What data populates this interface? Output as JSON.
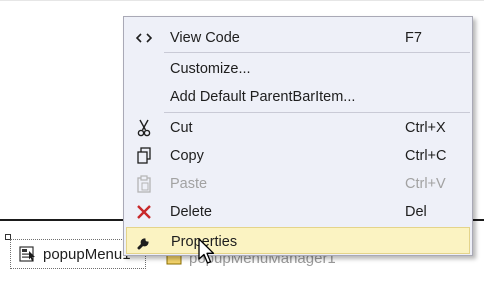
{
  "menu": {
    "items": [
      {
        "label": "View Code",
        "shortcut": "F7",
        "icon": "code-icon"
      },
      {
        "label": "Customize...",
        "shortcut": "",
        "icon": ""
      },
      {
        "label": "Add Default ParentBarItem...",
        "shortcut": "",
        "icon": ""
      },
      {
        "label": "Cut",
        "shortcut": "Ctrl+X",
        "icon": "scissors-icon"
      },
      {
        "label": "Copy",
        "shortcut": "Ctrl+C",
        "icon": "copy-icon"
      },
      {
        "label": "Paste",
        "shortcut": "Ctrl+V",
        "icon": "paste-icon",
        "disabled": true
      },
      {
        "label": "Delete",
        "shortcut": "Del",
        "icon": "delete-icon"
      },
      {
        "label": "Properties",
        "shortcut": "",
        "icon": "wrench-icon",
        "highlighted": true
      }
    ]
  },
  "tray": {
    "component_label": "popupMenu1",
    "second_component_label": "popupMenuManager1"
  },
  "colors": {
    "menu_bg": "#eef0f8",
    "highlight_bg": "#fbf3c2",
    "delete_icon": "#c8282a",
    "disabled_text": "#a2a2a2"
  }
}
